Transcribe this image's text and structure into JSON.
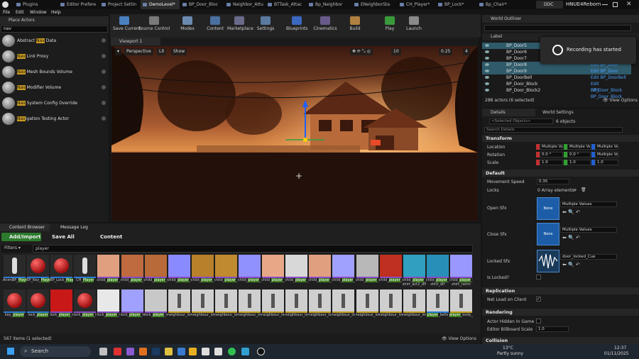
{
  "titlebar": {
    "tabs": [
      "Plugins",
      "Editor Prefere",
      "Project Settin",
      "DemoLevel*",
      "BP_Door_Bloc",
      "Neighbor_Attu",
      "BTTask_Attac",
      "Bp_Neighbor",
      "ENeighborSta",
      "CH_Player*",
      "BP_Lock*",
      "Bp_Chair*"
    ],
    "active_tab": "DemoLevel*",
    "ddc_label": "DDC",
    "project_name": "HNUE4Reborn"
  },
  "menubar": {
    "items": [
      "File",
      "Edit",
      "Window",
      "Help"
    ]
  },
  "toolbar": {
    "buttons": [
      "Save Current",
      "Source Control",
      "Modes",
      "Content",
      "Marketplace",
      "Settings",
      "Blueprints",
      "Cinematics",
      "Build",
      "Play",
      "Launch"
    ]
  },
  "place_actors": {
    "tab_label": "Place Actors",
    "search_value": "nav",
    "items": [
      {
        "prefix": "Abstract ",
        "match": "Nav",
        "suffix": " Data"
      },
      {
        "prefix": "",
        "match": "Nav",
        "suffix": " Link Proxy"
      },
      {
        "prefix": "",
        "match": "Nav",
        "suffix": " Mesh Bounds Volume"
      },
      {
        "prefix": "",
        "match": "Nav",
        "suffix": " Modifier Volume"
      },
      {
        "prefix": "",
        "match": "Nav",
        "suffix": " System Config Override"
      },
      {
        "prefix": "",
        "match": "Nav",
        "suffix": "igation Testing Actor"
      }
    ]
  },
  "viewport": {
    "tab_label": "Viewport 1",
    "buttons": [
      "Perspective",
      "Lit",
      "Show"
    ],
    "right_values": [
      "10",
      "0.25",
      "4"
    ]
  },
  "content_browser": {
    "tabs": [
      "Content Browser",
      "Message Log"
    ],
    "add_import_label": "Add/Import",
    "save_all_label": "Save All",
    "path": "Content",
    "filters_label": "Filters",
    "search_value": "player",
    "status_text": "567 items (1 selected)",
    "view_options_label": "View Options",
    "row1": [
      {
        "pre": "AnimBP_",
        "hl": "Player",
        "post": "",
        "thumb": "char",
        "type": "#2a7ad6"
      },
      {
        "pre": "BP_Key_",
        "hl": "Player",
        "post": "",
        "thumb": "redball",
        "type": "#2a7ad6"
      },
      {
        "pre": "BP_Lock_",
        "hl": "Player",
        "post": "",
        "thumb": "redball",
        "type": "#2a7ad6"
      },
      {
        "pre": "CH_",
        "hl": "Player",
        "post": "",
        "thumb": "char2",
        "type": "#2a7ad6"
      },
      {
        "pre": "child_",
        "hl": "player",
        "post": "_head_dif",
        "thumb": "#e0a080",
        "type": "#8a4ac8"
      },
      {
        "pre": "child_",
        "hl": "player",
        "post": "_shoes_act2_dif",
        "thumb": "#c06a40",
        "type": "#8a4ac8"
      },
      {
        "pre": "child_",
        "hl": "player",
        "post": "_shoes_dif",
        "thumb": "#b86a38",
        "type": "#8a4ac8"
      },
      {
        "pre": "child_",
        "hl": "player",
        "post": "_shoes_norm",
        "thumb": "#8a8aff",
        "type": "#8a4ac8"
      },
      {
        "pre": "child_",
        "hl": "player",
        "post": "_shirt_act2_dif",
        "thumb": "#b8802a",
        "type": "#8a4ac8"
      },
      {
        "pre": "child_",
        "hl": "player",
        "post": "_shirt_dif",
        "thumb": "#c08a30",
        "type": "#8a4ac8"
      },
      {
        "pre": "child_",
        "hl": "player",
        "post": "_shirt_norm",
        "thumb": "#9090ff",
        "type": "#8a4ac8"
      },
      {
        "pre": "child_",
        "hl": "player",
        "post": "_skin_act2_dif",
        "thumb": "#e8a888",
        "type": "#8a4ac8"
      },
      {
        "pre": "child_",
        "hl": "player",
        "post": "_skin_act2_rough",
        "thumb": "#d8d8d8",
        "type": "#8a4ac8"
      },
      {
        "pre": "child_",
        "hl": "player",
        "post": "_skin_dif",
        "thumb": "#e0a080",
        "type": "#8a4ac8"
      },
      {
        "pre": "child_",
        "hl": "player",
        "post": "_skin_norm",
        "thumb": "#a0a0ff",
        "type": "#8a4ac8"
      },
      {
        "pre": "child_",
        "hl": "player",
        "post": "_skin_rough",
        "thumb": "#b8b8b8",
        "type": "#8a4ac8"
      },
      {
        "pre": "child_",
        "hl": "player",
        "post": "_skin_sss",
        "thumb": "#c03020",
        "type": "#8a4ac8"
      },
      {
        "pre": "child_",
        "hl": "player",
        "post": "_T-shirt_act2_dif",
        "thumb": "#30a0c0",
        "type": "#8a4ac8"
      },
      {
        "pre": "child_",
        "hl": "player",
        "post": "_T-shirt_dif",
        "thumb": "#2890b8",
        "type": "#8a4ac8"
      },
      {
        "pre": "child_",
        "hl": "player",
        "post": "_T-shirt_norm",
        "thumb": "#9898ff",
        "type": "#8a4ac8"
      }
    ],
    "row2": [
      {
        "pre": "key_",
        "hl": "player",
        "post": "",
        "thumb": "redkey",
        "type": "#2a7ad6"
      },
      {
        "pre": "lock_",
        "hl": "player",
        "post": "",
        "thumb": "redlock",
        "type": "#2a7ad6"
      },
      {
        "pre": "lock_",
        "hl": "player",
        "post": "_dif",
        "thumb": "#c81818",
        "type": "#8a4ac8"
      },
      {
        "pre": "lock_",
        "hl": "player",
        "post": "_lmet",
        "thumb": "redball2",
        "type": "#8a4ac8"
      },
      {
        "pre": "lock_",
        "hl": "player",
        "post": "_met",
        "thumb": "#e8e8e8",
        "type": "#8a4ac8"
      },
      {
        "pre": "lock_",
        "hl": "player",
        "post": "_norm",
        "thumb": "#a0a0ff",
        "type": "#8a4ac8"
      },
      {
        "pre": "lock_",
        "hl": "player",
        "post": "_rough",
        "thumb": "#c8c8c8",
        "type": "#8a4ac8"
      },
      {
        "pre": "neighbour_",
        "hl": "",
        "post": "lowpoly_Anim_anim",
        "thumb": "fig",
        "type": "#c8a020"
      },
      {
        "pre": "neighbour_",
        "hl": "",
        "post": "lowpoly_Anim_basis_WOOD",
        "thumb": "fig",
        "type": "#c8a020"
      },
      {
        "pre": "neighbour_",
        "hl": "",
        "post": "lowpoly_Anim_closes",
        "thumb": "fig",
        "type": "#c8a020"
      },
      {
        "pre": "neighbour_",
        "hl": "",
        "post": "lowpoly_Anim_head_WOOD",
        "thumb": "fig",
        "type": "#c8a020"
      },
      {
        "pre": "neighbour_",
        "hl": "",
        "post": "lowpoly_Anim_neck_WOOD",
        "thumb": "fig",
        "type": "#c8a020"
      },
      {
        "pre": "neighbour_",
        "hl": "",
        "post": "lowpoly_Anim_pants",
        "thumb": "fig",
        "type": "#c8a020"
      },
      {
        "pre": "neighbour_",
        "hl": "",
        "post": "lowpoly_Anim_tis_idle_2",
        "thumb": "fig",
        "type": "#c8a020"
      },
      {
        "pre": "neighbour_",
        "hl": "",
        "post": "lowpoly_Anim_tis_idle",
        "thumb": "fig",
        "type": "#c8a020"
      },
      {
        "pre": "neighbour_",
        "hl": "",
        "post": "lowpoly_Anim_tis_wbfs",
        "thumb": "fig",
        "type": "#c8a020"
      },
      {
        "pre": "neighbour_",
        "hl": "",
        "post": "lowpoly_Anim_nio_WOOD",
        "thumb": "fig",
        "type": "#c8a020"
      },
      {
        "pre": "neighbour_",
        "hl": "",
        "post": "lowpoly_Anim_tis_WOOD",
        "thumb": "fig",
        "type": "#c8a020"
      },
      {
        "pre": "",
        "hl": "player",
        "post": "_bells",
        "thumb": "fig",
        "type": "#2a7ad6"
      },
      {
        "pre": "",
        "hl": "player",
        "post": "_body_Anim_guestmints",
        "thumb": "fig",
        "type": "#c8a020"
      }
    ]
  },
  "world_outliner": {
    "tab_label": "World Outliner",
    "col_label": "Label",
    "rows": [
      {
        "name": "BP_Door5",
        "type": "Edit BP_Door",
        "selected": true
      },
      {
        "name": "BP_Door6",
        "type": "Edit BP_Door",
        "selected": false
      },
      {
        "name": "BP_Door7",
        "type": "Edit BP_Door",
        "selected": false
      },
      {
        "name": "BP_Door8",
        "type": "Edit BP_Door",
        "selected": true
      },
      {
        "name": "BP_Door9",
        "type": "Edit BP_Door",
        "selected": true
      },
      {
        "name": "BP_DoorBell",
        "type": "Edit BP_DoorBell",
        "selected": false
      },
      {
        "name": "BP_Door_Block",
        "type": "Edit BP_Door_Block",
        "selected": false
      },
      {
        "name": "BP_Door_Block2",
        "type": "Edit BP_Door_Block",
        "selected": false
      }
    ],
    "status_text": "288 actors (6 selected)",
    "view_options_label": "View Options"
  },
  "toast": {
    "text": "Recording has started"
  },
  "details": {
    "tabs": [
      "Details",
      "World Settings"
    ],
    "selected_placeholder": "<Selected Objects>",
    "objects_count": "6 objects",
    "search_placeholder": "Search Details",
    "transform_label": "Transform",
    "location_label": "Location",
    "rotation_label": "Rotation",
    "scale_label": "Scale",
    "location_values": [
      "Multiple Val",
      "Multiple Val",
      "Multiple Val"
    ],
    "rotation_values": [
      "0.0 °",
      "0.0 °",
      "Multiple Val"
    ],
    "scale_values": [
      "1.0",
      "1.0",
      "1.0"
    ],
    "default_label": "Default",
    "movement_speed_label": "Movement Speed",
    "movement_speed_value": "0.35",
    "locks_label": "Locks",
    "locks_value": "0 Array elements",
    "open_sfx_label": "Open Sfx",
    "open_sfx_value": "Multiple Values",
    "close_sfx_label": "Close Sfx",
    "close_sfx_value": "Multiple Values",
    "locked_sfx_label": "Locked Sfx",
    "locked_sfx_value": "door_locked_Cue",
    "none_label": "None",
    "is_locked_label": "Is Locked?",
    "replication_label": "Replication",
    "net_load_label": "Net Load on Client",
    "rendering_label": "Rendering",
    "actor_hidden_label": "Actor Hidden In Game",
    "billboard_label": "Editor Billboard Scale",
    "billboard_value": "1.0",
    "collision_label": "Collision"
  },
  "taskbar": {
    "search_label": "Search",
    "weather_temp": "13°C",
    "weather_desc": "Partly sunny",
    "time": "12:37",
    "date": "01/11/2025"
  },
  "colors": {
    "accent": "#4ea0ff",
    "selection": "#2f5a6a",
    "highlight": "#3b7a1c"
  }
}
